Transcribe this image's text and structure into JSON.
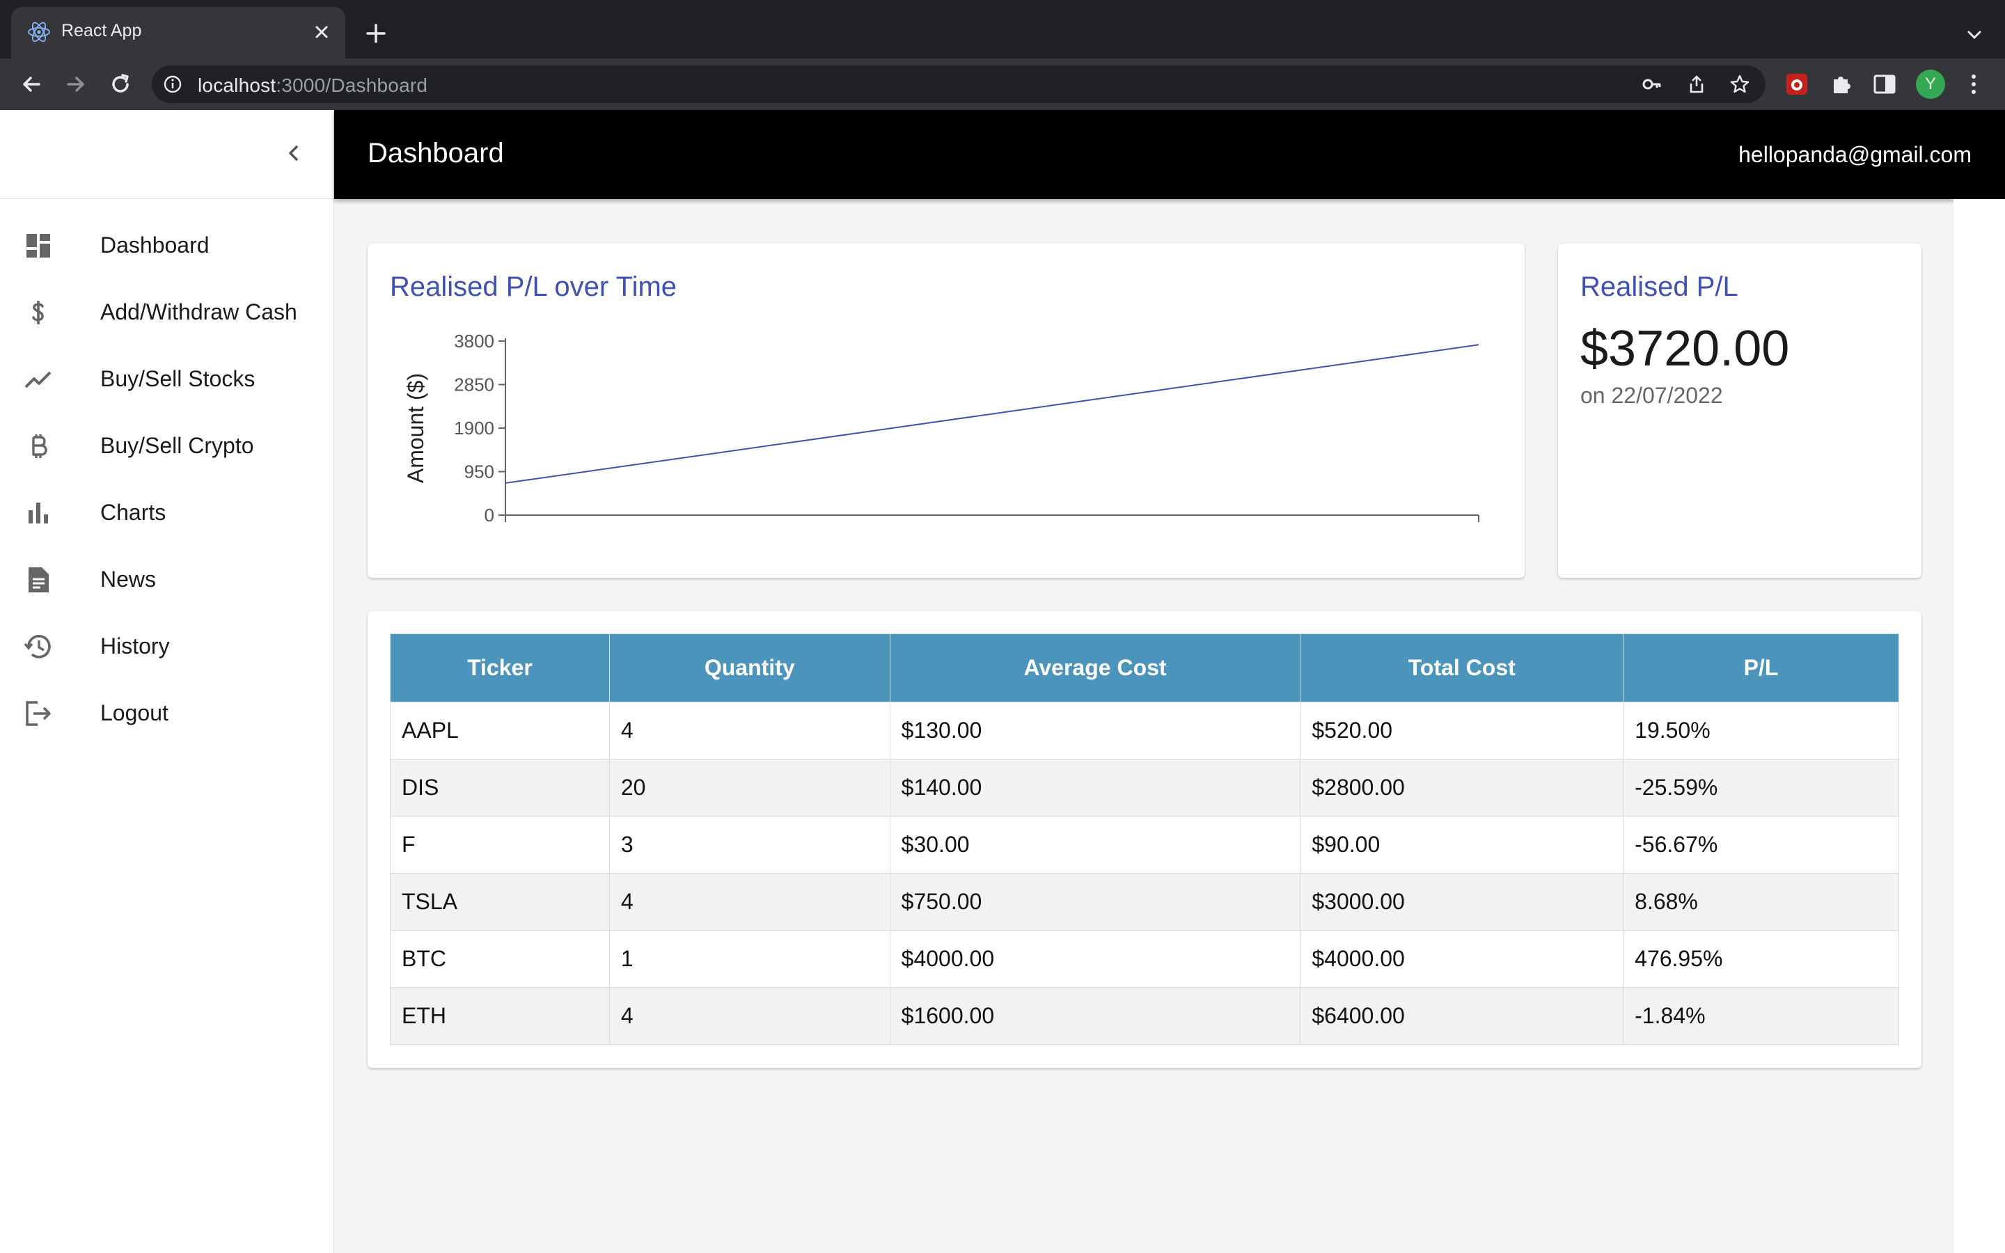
{
  "browser": {
    "tab_title": "React App",
    "url_host": "localhost",
    "url_rest": ":3000/Dashboard",
    "profile_initial": "Y"
  },
  "header": {
    "title": "Dashboard",
    "user_email": "hellopanda@gmail.com"
  },
  "sidebar": {
    "items": [
      {
        "label": "Dashboard",
        "icon": "dashboard-icon"
      },
      {
        "label": "Add/Withdraw Cash",
        "icon": "dollar-icon"
      },
      {
        "label": "Buy/Sell Stocks",
        "icon": "trending-up-icon"
      },
      {
        "label": "Buy/Sell Crypto",
        "icon": "bitcoin-icon"
      },
      {
        "label": "Charts",
        "icon": "bar-chart-icon"
      },
      {
        "label": "News",
        "icon": "article-icon"
      },
      {
        "label": "History",
        "icon": "history-icon"
      },
      {
        "label": "Logout",
        "icon": "logout-icon"
      }
    ]
  },
  "chart_card": {
    "title": "Realised P/L over Time"
  },
  "chart_data": {
    "type": "line",
    "title": "Realised P/L over Time",
    "xlabel": "",
    "ylabel": "Amount ($)",
    "yticks": [
      0,
      950,
      1900,
      2850,
      3800
    ],
    "ylim": [
      0,
      3800
    ],
    "series": [
      {
        "values": [
          700,
          3720
        ]
      }
    ],
    "color": "#3f51b5"
  },
  "summary": {
    "title": "Realised P/L",
    "value": "$3720.00",
    "date": "on 22/07/2022"
  },
  "table": {
    "headers": [
      "Ticker",
      "Quantity",
      "Average Cost",
      "Total Cost",
      "P/L"
    ],
    "rows": [
      [
        "AAPL",
        "4",
        "$130.00",
        "$520.00",
        "19.50%"
      ],
      [
        "DIS",
        "20",
        "$140.00",
        "$2800.00",
        "-25.59%"
      ],
      [
        "F",
        "3",
        "$30.00",
        "$90.00",
        "-56.67%"
      ],
      [
        "TSLA",
        "4",
        "$750.00",
        "$3000.00",
        "8.68%"
      ],
      [
        "BTC",
        "1",
        "$4000.00",
        "$4000.00",
        "476.95%"
      ],
      [
        "ETH",
        "4",
        "$1600.00",
        "$6400.00",
        "-1.84%"
      ]
    ]
  }
}
